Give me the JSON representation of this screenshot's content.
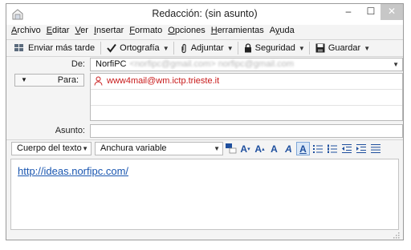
{
  "window": {
    "title": "Redacción: (sin asunto)",
    "minimize": "–",
    "maximize": "☐",
    "close": "✕"
  },
  "menu": {
    "items": [
      {
        "label": "Archivo",
        "accel": "A",
        "rest": "rchivo"
      },
      {
        "label": "Editar",
        "accel": "E",
        "rest": "ditar"
      },
      {
        "label": "Ver",
        "accel": "V",
        "rest": "er"
      },
      {
        "label": "Insertar",
        "accel": "I",
        "rest": "nsertar"
      },
      {
        "label": "Formato",
        "accel": "F",
        "rest": "ormato"
      },
      {
        "label": "Opciones",
        "accel": "O",
        "rest": "pciones"
      },
      {
        "label": "Herramientas",
        "accel": "H",
        "rest": "erramientas"
      },
      {
        "label": "Ayuda",
        "accel": "y",
        "pre": "A",
        "rest": "uda"
      }
    ]
  },
  "toolbar": {
    "send_later": "Enviar más tarde",
    "spelling": "Ortografía",
    "attach": "Adjuntar",
    "security": "Seguridad",
    "save": "Guardar"
  },
  "header": {
    "from_label": "De:",
    "from_name": "NorfiPC",
    "from_blurred": "<norfipc@gmail.com>   norfipc@gmail.com",
    "to_type_label": "Para:",
    "to_recipient": "www4mail@wm.ictp.trieste.it",
    "subject_label": "Asunto:",
    "subject_value": ""
  },
  "format_bar": {
    "paragraph_style": "Cuerpo del texto",
    "font_width": "Anchura variable"
  },
  "body": {
    "link_text": "http://ideas.norfipc.com/"
  },
  "colors": {
    "accent": "#1e4f9e",
    "recipient_text": "#c81a1a",
    "link": "#1a56b0"
  }
}
